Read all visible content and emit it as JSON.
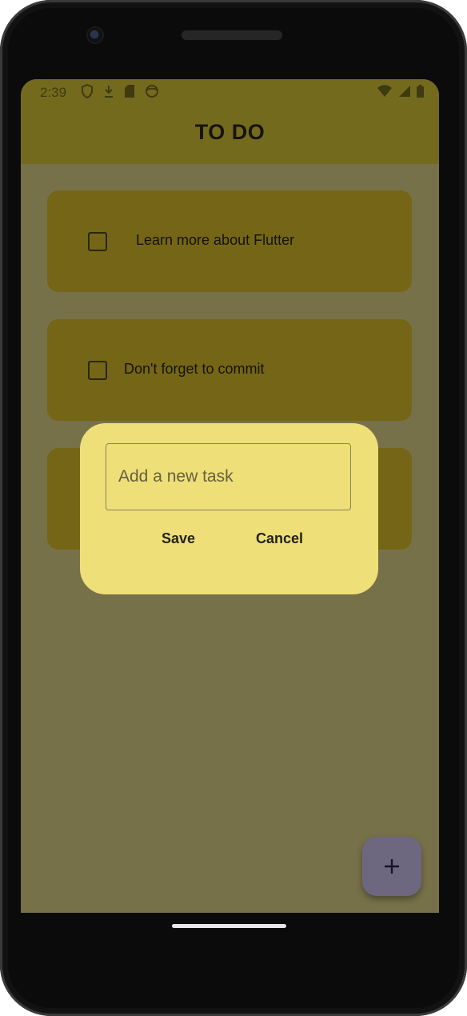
{
  "status_bar": {
    "time": "2:39",
    "left_icons": [
      "shield-icon",
      "download-icon",
      "sd-card-icon",
      "face-icon"
    ],
    "right_icons": [
      "wifi-icon",
      "signal-icon",
      "battery-icon"
    ]
  },
  "app_bar": {
    "title": "TO DO"
  },
  "tasks": [
    {
      "label": "Learn more about Flutter",
      "checked": false
    },
    {
      "label": "Don't forget to commit",
      "checked": false
    },
    {
      "label": "",
      "checked": false
    }
  ],
  "dialog": {
    "input_placeholder": "Add a new task",
    "input_value": "",
    "save_label": "Save",
    "cancel_label": "Cancel"
  },
  "fab": {
    "icon": "plus-icon"
  },
  "colors": {
    "app_bar": "#746a1e",
    "background_scrim": "#77714a",
    "task_tile": "#746616",
    "dialog": "#eedf79",
    "fab": "#6e6780"
  }
}
